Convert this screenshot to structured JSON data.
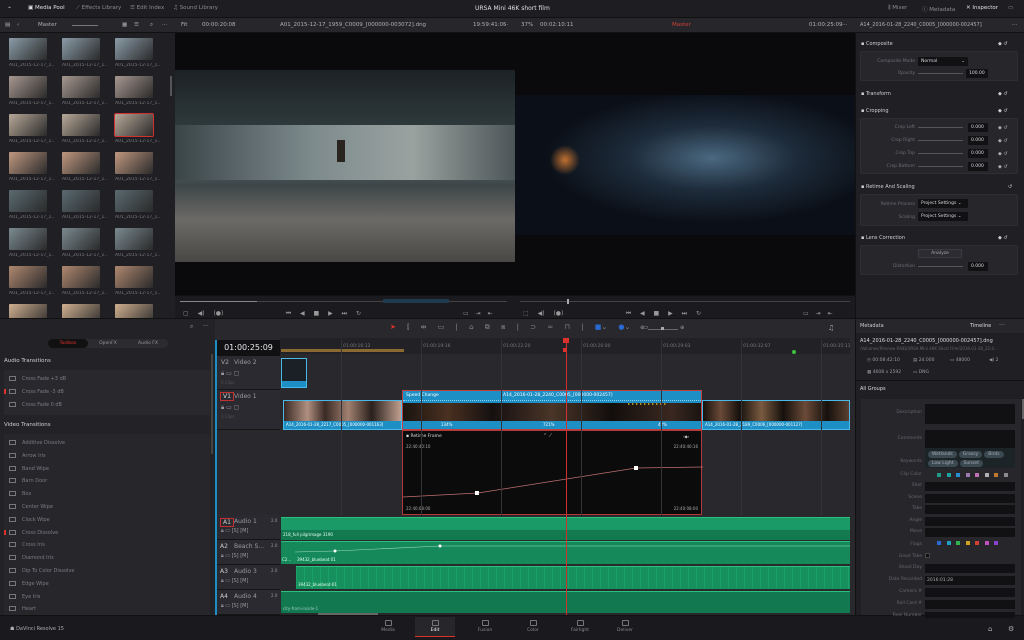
{
  "topbar": {
    "media_pool": "Media Pool",
    "effects_library": "Effects Library",
    "edit_index": "Edit Index",
    "sound_library": "Sound Library",
    "title": "URSA Mini 46K short film",
    "mixer": "Mixer",
    "metadata": "Metadata",
    "inspector": "Inspector"
  },
  "media_pool": {
    "bin": "Master",
    "clips": [
      "A01_2015-12-17_1...",
      "A01_2015-12-17_1...",
      "A01_2015-12-17_1...",
      "A01_2015-12-17_1...",
      "A01_2015-12-17_1...",
      "A01_2015-12-17_1...",
      "A01_2015-12-17_1...",
      "A01_2015-12-17_1...",
      "A01_2015-12-17_1...",
      "A01_2015-12-17_1...",
      "A01_2015-12-17_1...",
      "A01_2015-12-17_1...",
      "A01_2015-12-17_1...",
      "A01_2015-12-17_1...",
      "A01_2015-12-17_1...",
      "A01_2015-12-17_1...",
      "A01_2015-12-17_1...",
      "A01_2015-12-17_1...",
      "A01_2015-12-17_1...",
      "A01_2015-12-17_1...",
      "A01_2015-12-17_1...",
      "A01_2015-12-17_1...",
      "A01_2015-12-17_1...",
      "A01_2015-12-17_1..."
    ],
    "selected_index": 8
  },
  "source_viewer": {
    "zoom": "Fit",
    "duration": "00:00:20:08",
    "clip": "A01_2015-12-17_1959_C0009_[000000-003072].dng",
    "timecode": "19:59:41:05"
  },
  "timeline_viewer": {
    "zoom": "37%",
    "duration": "00:02:10:11",
    "name": "Master",
    "timecode": "01:00:25:09"
  },
  "inspector": {
    "clip": "A14_2016-01-28_2240_C0005_[000000-002457]",
    "composite": {
      "title": "Composite",
      "mode_label": "Composite Mode",
      "mode": "Normal",
      "opacity_label": "Opacity",
      "opacity": "100.00"
    },
    "transform": {
      "title": "Transform"
    },
    "cropping": {
      "title": "Cropping",
      "rows": [
        {
          "label": "Crop Left",
          "value": "0.000"
        },
        {
          "label": "Crop Right",
          "value": "0.000"
        },
        {
          "label": "Crop Top",
          "value": "0.000"
        },
        {
          "label": "Crop Bottom",
          "value": "0.000"
        }
      ]
    },
    "retime": {
      "title": "Retime And Scaling",
      "process_label": "Retime Process",
      "process": "Project Settings",
      "scaling_label": "Scaling",
      "scaling": "Project Settings"
    },
    "lens": {
      "title": "Lens Correction",
      "analyze": "Analyze",
      "distortion_label": "Distortion",
      "distortion": "0.000"
    }
  },
  "effects": {
    "tabs": [
      "Toolbox",
      "OpenFX",
      "Audio FX"
    ],
    "active_tab": 0,
    "audio_title": "Audio Transitions",
    "audio": [
      "Cross Fade +3 dB",
      "Cross Fade -3 dB",
      "Cross Fade 0 dB"
    ],
    "video_title": "Video Transitions",
    "video": [
      "Additive Dissolve",
      "Arrow Iris",
      "Band Wipe",
      "Barn Door",
      "Box",
      "Center Wipe",
      "Clock Wipe",
      "Cross Dissolve",
      "Cross Iris",
      "Diamond Iris",
      "Dip To Color Dissolve",
      "Edge Wipe",
      "Eye Iris",
      "Heart"
    ]
  },
  "timeline": {
    "timecode": "01:00:25:09",
    "ruler": [
      "01:00:16:12",
      "01:00:19:16",
      "01:00:22:20",
      "01:00:26:00",
      "01:00:29:03",
      "01:00:32:07",
      "01:00:35:11"
    ],
    "tracks": {
      "v2": {
        "id": "V2",
        "name": "Video 2",
        "clips": "0 Clips"
      },
      "v1": {
        "id": "V1",
        "name": "Video 1",
        "clips": "3 Clips"
      },
      "a1": {
        "id": "A1",
        "name": "Audio 1",
        "ch": "2.0"
      },
      "a2": {
        "id": "A2",
        "name": "Beach S...",
        "ch": "2.0"
      },
      "a3": {
        "id": "A3",
        "name": "Audio 3",
        "ch": "2.0"
      },
      "a4": {
        "id": "A4",
        "name": "Audio 4",
        "ch": "2.0"
      }
    },
    "v1_clips": [
      "A14_2016-01-28_2217_C0005_[000000-001163]",
      "A14_2016-01-28_2240_C0005_[000000-002457]",
      "A14_2016-01-28_2189_C0006_[000000-001127]"
    ],
    "speed_change": "Speed Change",
    "speeds": [
      "134%",
      "721%",
      "42%"
    ],
    "retime_frame": {
      "title": "Retime Frame",
      "top_left": "22:40:40:10",
      "top_right": "22:40:40:16",
      "bottom_left": "22:40:08:00",
      "bottom_right": "22:40:08:00"
    },
    "audio_clips": {
      "a1": "218_full pilgrimage 3190",
      "a2": "39432_bluebeat 01",
      "a2_prev": "C2...",
      "a3": "39432_bluebeat-01",
      "a4": "city-from-inside-1"
    }
  },
  "metadata": {
    "title": "Metadata",
    "scope": "Timeline",
    "file": "A14_2016-01-28_2240_C0005_[000000-002457].dng",
    "path": "/Volumes/Preview RAID/URSA Mini 46K Short Film/2016-01-28_22:4...",
    "duration": "00:08:42:10",
    "fps": "24.000",
    "rate": "48000",
    "channels": "2",
    "resolution": "4608 x 2592",
    "codec": "DNG",
    "group": "All Groups",
    "fields": [
      "Description",
      "Comments",
      "Keywords",
      "Clip Color",
      "Shot",
      "Scene",
      "Take",
      "Angle",
      "Move",
      "Flags",
      "Good Take",
      "Shoot Day",
      "Date Recorded",
      "Camera #",
      "Roll Card #",
      "Reel Number"
    ],
    "keywords": [
      "Wetlands",
      "Grassy",
      "Birds",
      "Low Light",
      "Sunset"
    ],
    "date_recorded": "2016:01:28",
    "clip_colors": [
      "#1e9a8a",
      "#1aa3a0",
      "#2a8fd0",
      "#9a7ab0",
      "#c070b0",
      "#b0b0b0",
      "#c07a30",
      "#8a8a8a"
    ],
    "flag_colors": [
      "#2a6ad0",
      "#20a0c0",
      "#30b050",
      "#d0a020",
      "#d04030",
      "#c050c0",
      "#8a40d0"
    ]
  },
  "pages": [
    "Media",
    "Edit",
    "Fusion",
    "Color",
    "Fairlight",
    "Deliver"
  ],
  "active_page": 1,
  "app": "DaVinci Resolve 15",
  "colors": {
    "accent_red": "#e0322c",
    "clip_blue": "#1d8fc4",
    "audio_green": "#15895a"
  }
}
